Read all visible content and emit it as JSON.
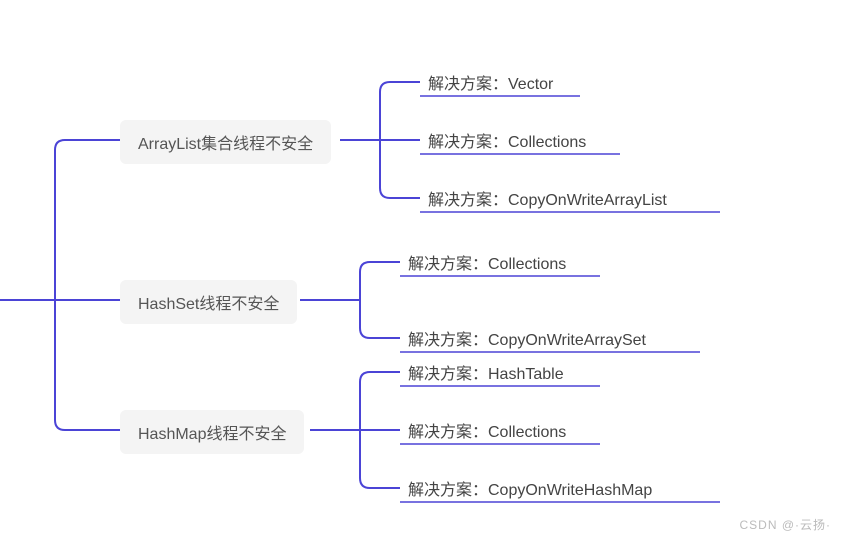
{
  "chart_data": {
    "type": "tree",
    "root": {
      "children": [
        {
          "label": "ArrayList集合线程不安全",
          "children": [
            {
              "label": "解决方案：Vector"
            },
            {
              "label": "解决方案：Collections"
            },
            {
              "label": "解决方案：CopyOnWriteArrayList"
            }
          ]
        },
        {
          "label": "HashSet线程不安全",
          "children": [
            {
              "label": "解决方案：Collections"
            },
            {
              "label": "解决方案：CopyOnWriteArraySet"
            }
          ]
        },
        {
          "label": "HashMap线程不安全",
          "children": [
            {
              "label": "解决方案：HashTable"
            },
            {
              "label": "解决方案：Collections"
            },
            {
              "label": "解决方案：CopyOnWriteHashMap"
            }
          ]
        }
      ]
    }
  },
  "nodes": {
    "n1": "ArrayList集合线程不安全",
    "n1c1": "解决方案：Vector",
    "n1c2": "解决方案：Collections",
    "n1c3": "解决方案：CopyOnWriteArrayList",
    "n2": "HashSet线程不安全",
    "n2c1": "解决方案：Collections",
    "n2c2": "解决方案：CopyOnWriteArraySet",
    "n3": "HashMap线程不安全",
    "n3c1": "解决方案：HashTable",
    "n3c2": "解决方案：Collections",
    "n3c3": "解决方案：CopyOnWriteHashMap"
  },
  "watermark": "CSDN @·云扬·",
  "colors": {
    "connector": "#4b44d6",
    "nodeBg": "#f4f4f4"
  }
}
